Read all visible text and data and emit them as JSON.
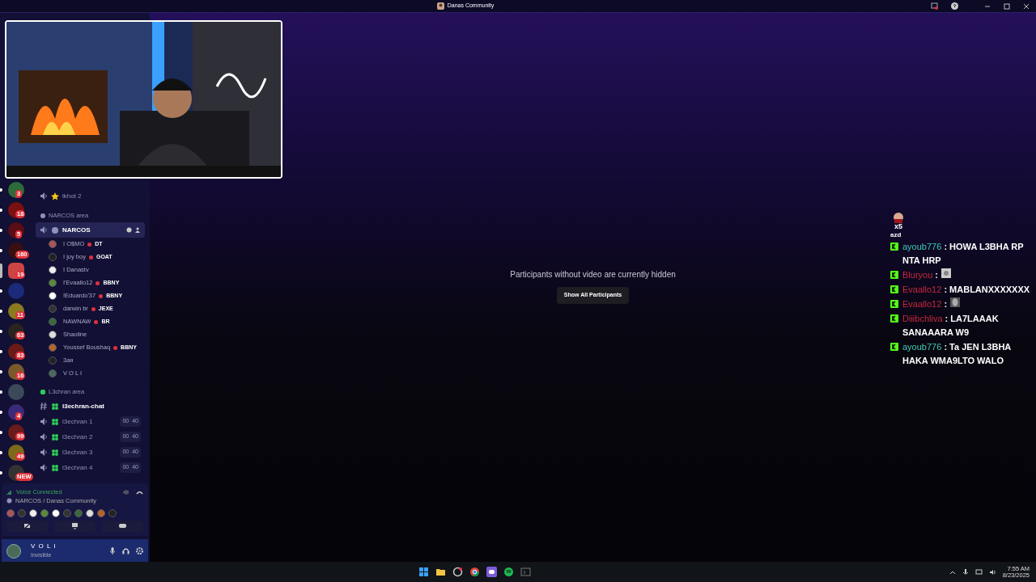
{
  "title_bar": {
    "title": "Danas Community"
  },
  "servers": [
    {
      "badge": "3",
      "unread": true,
      "selected": false
    },
    {
      "badge": "18",
      "unread": true,
      "selected": false
    },
    {
      "badge": "5",
      "unread": true,
      "selected": false
    },
    {
      "badge": "160",
      "unread": true,
      "selected": false
    },
    {
      "badge": "19",
      "unread": false,
      "selected": true
    },
    {
      "unread": true,
      "selected": false
    },
    {
      "badge": "11",
      "unread": true,
      "selected": false
    },
    {
      "badge": "63",
      "unread": true,
      "selected": false
    },
    {
      "badge": "83",
      "unread": true,
      "selected": false
    },
    {
      "badge": "16",
      "unread": true,
      "selected": false
    },
    {
      "unread": true,
      "selected": false
    },
    {
      "badge": "4",
      "unread": true,
      "selected": false
    },
    {
      "badge": "99",
      "unread": true,
      "selected": false
    },
    {
      "badge": "49",
      "unread": true,
      "selected": false
    },
    {
      "badge": "NEW",
      "unread": true,
      "selected": false
    }
  ],
  "channels": [
    {
      "kind": "voice",
      "name": "lkhot 2",
      "selected": false
    },
    {
      "kind": "category",
      "name": "NARCOS area"
    },
    {
      "kind": "voice",
      "name": "NARCOS",
      "selected": true,
      "members": [
        {
          "name": "I O$MO",
          "tag": "DT"
        },
        {
          "name": "I joy boy",
          "tag": "GOAT"
        },
        {
          "name": "I Danastv"
        },
        {
          "name": "I'Evaallo12",
          "tag": "BBNY"
        },
        {
          "name": "!Eduardo'37",
          "tag": "BBNY"
        },
        {
          "name": "darwin br",
          "tag": "JEXE"
        },
        {
          "name": "NAWNAW",
          "tag": "BR"
        },
        {
          "name": "Shaoline"
        },
        {
          "name": "Youssef Boushaq",
          "tag": "BBNY"
        },
        {
          "name": "3ая"
        },
        {
          "name": "V O L I"
        }
      ]
    },
    {
      "kind": "category",
      "name": "L3chran area"
    },
    {
      "kind": "text",
      "name": "l3echran-chat",
      "selected": false
    },
    {
      "kind": "voice",
      "name": "l3echran 1",
      "selected": false,
      "count": "00",
      "limit": "40"
    },
    {
      "kind": "voice",
      "name": "l3echran 2",
      "selected": false,
      "count": "00",
      "limit": "40"
    },
    {
      "kind": "voice",
      "name": "l3echran 3",
      "selected": false,
      "count": "00",
      "limit": "40"
    },
    {
      "kind": "voice",
      "name": "l3echran 4",
      "selected": false,
      "count": "00",
      "limit": "40"
    }
  ],
  "voice_panel": {
    "status": "Voice Connected",
    "location": "NARCOS / Danas Community"
  },
  "user_panel": {
    "name": "V O L I",
    "status": "Invisible"
  },
  "stage": {
    "notice": "Participants without video are currently hidden",
    "button": "Show All Participants"
  },
  "chat_overlay": {
    "top_count": "x5",
    "top_user": "azd",
    "messages": [
      {
        "kind": "text",
        "user": "ayoub776",
        "color": "#3fc9b4",
        "text": ": HOWA L3BHA RP NTA HRP"
      },
      {
        "kind": "emote",
        "user": "Bluryou",
        "color": "#c8283f",
        "text": ":"
      },
      {
        "kind": "text",
        "user": "Evaallo12",
        "color": "#c8283f",
        "text": ": MABLANXXXXXXX"
      },
      {
        "kind": "emote",
        "user": "Evaallo12",
        "color": "#c8283f",
        "text": ":"
      },
      {
        "kind": "text",
        "user": "Diiibchliva",
        "color": "#c8283f",
        "text": ": LA7LAAAK SANAAARA W9"
      },
      {
        "kind": "text",
        "user": "ayoub776",
        "color": "#3fc9b4",
        "text": ": Ta JEN L3BHA HAKA WMA9LTO WALO"
      }
    ]
  },
  "taskbar": {
    "time": "7:55 AM",
    "date": "8/23/2025"
  }
}
